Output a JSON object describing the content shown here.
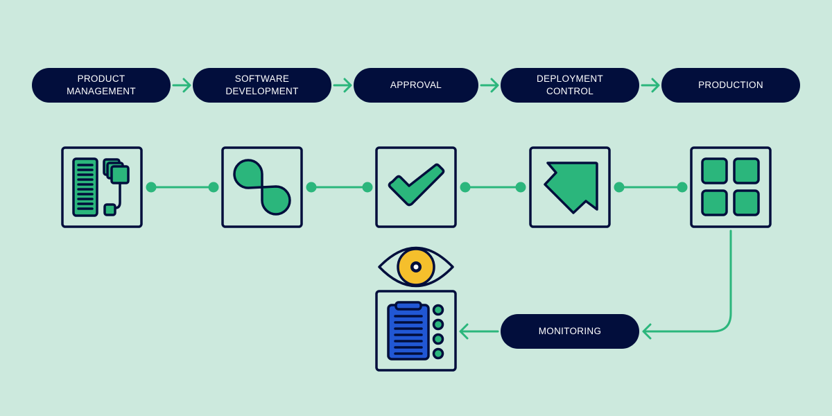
{
  "diagram": {
    "title": "",
    "colors": {
      "background": "#cce9dd",
      "pill": "#020e3c",
      "pill_text": "#ffffff",
      "accent_green": "#2bb67c",
      "outline": "#020e3c",
      "eye_yellow": "#f5bf2c",
      "clipboard_blue": "#2157d4"
    },
    "stages": [
      {
        "label": "PRODUCT\nMANAGEMENT",
        "icon": "server-rack-stack-icon"
      },
      {
        "label": "SOFTWARE\nDEVELOPMENT",
        "icon": "infinity-loop-icon"
      },
      {
        "label": "APPROVAL",
        "icon": "checkmark-icon"
      },
      {
        "label": "DEPLOYMENT\nCONTROL",
        "icon": "arrow-up-right-icon"
      },
      {
        "label": "PRODUCTION",
        "icon": "grid-four-squares-icon"
      }
    ],
    "monitoring": {
      "label": "MONITORING",
      "icon": "clipboard-checklist-icon",
      "overlay_icon": "eye-icon"
    },
    "flow": [
      {
        "from": "PRODUCT MANAGEMENT",
        "to": "SOFTWARE DEVELOPMENT"
      },
      {
        "from": "SOFTWARE DEVELOPMENT",
        "to": "APPROVAL"
      },
      {
        "from": "APPROVAL",
        "to": "DEPLOYMENT CONTROL"
      },
      {
        "from": "DEPLOYMENT CONTROL",
        "to": "PRODUCTION"
      },
      {
        "from": "PRODUCTION",
        "to": "MONITORING"
      },
      {
        "from": "MONITORING",
        "to": "monitoring-dashboard"
      }
    ]
  }
}
